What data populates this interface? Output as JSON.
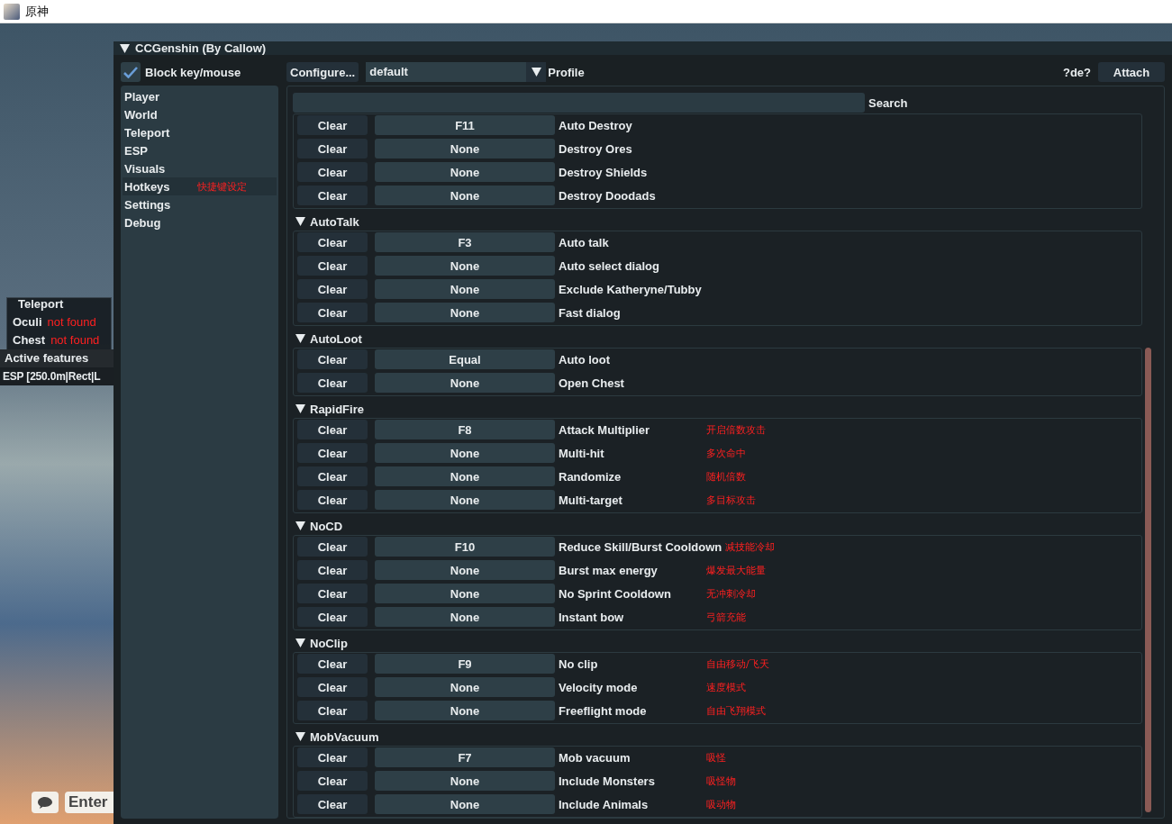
{
  "window": {
    "title": "原神"
  },
  "overlay": {
    "teleport_panel": {
      "title": "Teleport",
      "rows": [
        {
          "label": "Oculi",
          "status": "not found"
        },
        {
          "label": "Chest",
          "status": "not found"
        }
      ]
    },
    "active_features": {
      "title": "Active features",
      "items": [
        "ESP [250.0m|Rect|L"
      ]
    },
    "chat": {
      "placeholder": "Enter"
    }
  },
  "menu": {
    "title": "CCGenshin (By Callow)",
    "expanded": true,
    "block_input": {
      "label": "Block key/mouse",
      "checked": true
    },
    "sidebar": [
      {
        "label": "Player",
        "selected": false
      },
      {
        "label": "World",
        "selected": false
      },
      {
        "label": "Teleport",
        "selected": false
      },
      {
        "label": "ESP",
        "selected": false
      },
      {
        "label": "Visuals",
        "selected": false
      },
      {
        "label": "Hotkeys",
        "selected": true,
        "note": "快捷键设定"
      },
      {
        "label": "Settings",
        "selected": false
      },
      {
        "label": "Debug",
        "selected": false
      }
    ],
    "toolbar": {
      "configure": "Configure...",
      "profile_value": "default",
      "profile_label": "Profile",
      "hint": "?de?",
      "attach": "Attach"
    },
    "search": {
      "label": "Search"
    },
    "groups": [
      {
        "rows": [
          {
            "clear": "Clear",
            "key": "F11",
            "label": "Auto Destroy"
          },
          {
            "clear": "Clear",
            "key": "None",
            "label": "Destroy Ores"
          },
          {
            "clear": "Clear",
            "key": "None",
            "label": "Destroy Shields"
          },
          {
            "clear": "Clear",
            "key": "None",
            "label": "Destroy Doodads"
          }
        ]
      },
      {
        "title": "AutoTalk",
        "expanded": true,
        "rows": [
          {
            "clear": "Clear",
            "key": "F3",
            "label": "Auto talk"
          },
          {
            "clear": "Clear",
            "key": "None",
            "label": "Auto select dialog"
          },
          {
            "clear": "Clear",
            "key": "None",
            "label": "Exclude Katheryne/Tubby"
          },
          {
            "clear": "Clear",
            "key": "None",
            "label": "Fast dialog"
          }
        ]
      },
      {
        "title": "AutoLoot",
        "expanded": true,
        "rows": [
          {
            "clear": "Clear",
            "key": "Equal",
            "label": "Auto loot"
          },
          {
            "clear": "Clear",
            "key": "None",
            "label": "Open Chest"
          }
        ]
      },
      {
        "title": "RapidFire",
        "expanded": true,
        "rows": [
          {
            "clear": "Clear",
            "key": "F8",
            "label": "Attack Multiplier",
            "note": "开启倍数攻击"
          },
          {
            "clear": "Clear",
            "key": "None",
            "label": "Multi-hit",
            "note": "多次命中"
          },
          {
            "clear": "Clear",
            "key": "None",
            "label": "Randomize",
            "note": "随机倍数"
          },
          {
            "clear": "Clear",
            "key": "None",
            "label": "Multi-target",
            "note": "多目标攻击"
          }
        ]
      },
      {
        "title": "NoCD",
        "expanded": true,
        "rows": [
          {
            "clear": "Clear",
            "key": "F10",
            "label": "Reduce Skill/Burst Cooldown",
            "note": "减技能冷却"
          },
          {
            "clear": "Clear",
            "key": "None",
            "label": "Burst max energy",
            "note": "爆发最大能量"
          },
          {
            "clear": "Clear",
            "key": "None",
            "label": "No Sprint Cooldown",
            "note": "无冲刺冷却"
          },
          {
            "clear": "Clear",
            "key": "None",
            "label": "Instant bow",
            "note": "弓箭充能"
          }
        ]
      },
      {
        "title": "NoClip",
        "expanded": true,
        "rows": [
          {
            "clear": "Clear",
            "key": "F9",
            "label": "No clip",
            "note": "自由移动/飞天"
          },
          {
            "clear": "Clear",
            "key": "None",
            "label": "Velocity mode",
            "note": "速度模式"
          },
          {
            "clear": "Clear",
            "key": "None",
            "label": "Freeflight mode",
            "note": "自由飞翔模式"
          }
        ]
      },
      {
        "title": "MobVacuum",
        "expanded": true,
        "rows": [
          {
            "clear": "Clear",
            "key": "F7",
            "label": "Mob vacuum",
            "note": "吸怪"
          },
          {
            "clear": "Clear",
            "key": "None",
            "label": "Include Monsters",
            "note": "吸怪物"
          },
          {
            "clear": "Clear",
            "key": "None",
            "label": "Include Animals",
            "note": "吸动物"
          }
        ]
      }
    ]
  }
}
